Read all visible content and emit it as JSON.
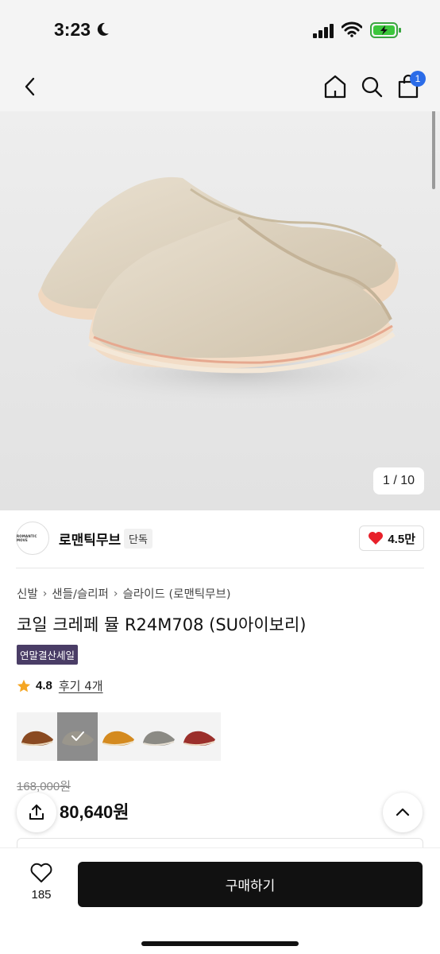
{
  "status_bar": {
    "time": "3:23"
  },
  "nav": {
    "cart_count": "1"
  },
  "gallery": {
    "pager": "1 / 10"
  },
  "brand": {
    "logo_text": "ROMANTIC MOVE",
    "name": "로맨틱무브",
    "tag": "단독",
    "likes": "4.5만"
  },
  "breadcrumb": [
    "신발",
    "샌들/슬리퍼",
    "슬라이드 (로맨틱무브)"
  ],
  "product": {
    "title": "코일 크레페 뮬 R24M708 (SU아이보리)",
    "badge": "연말결산세일",
    "rating": "4.8",
    "reviews": "후기 4개",
    "original_price": "168,000원",
    "price": "80,640원"
  },
  "swatches": [
    {
      "name": "brown",
      "color": "#8a4a22",
      "selected": false
    },
    {
      "name": "gray-beige",
      "color": "#9a968c",
      "selected": true
    },
    {
      "name": "mustard",
      "color": "#d48a1f",
      "selected": false
    },
    {
      "name": "gray",
      "color": "#8b8a84",
      "selected": false
    },
    {
      "name": "burgundy",
      "color": "#9b2f2b",
      "selected": false
    }
  ],
  "bottom": {
    "wish_count": "185",
    "buy_label": "구매하기"
  }
}
